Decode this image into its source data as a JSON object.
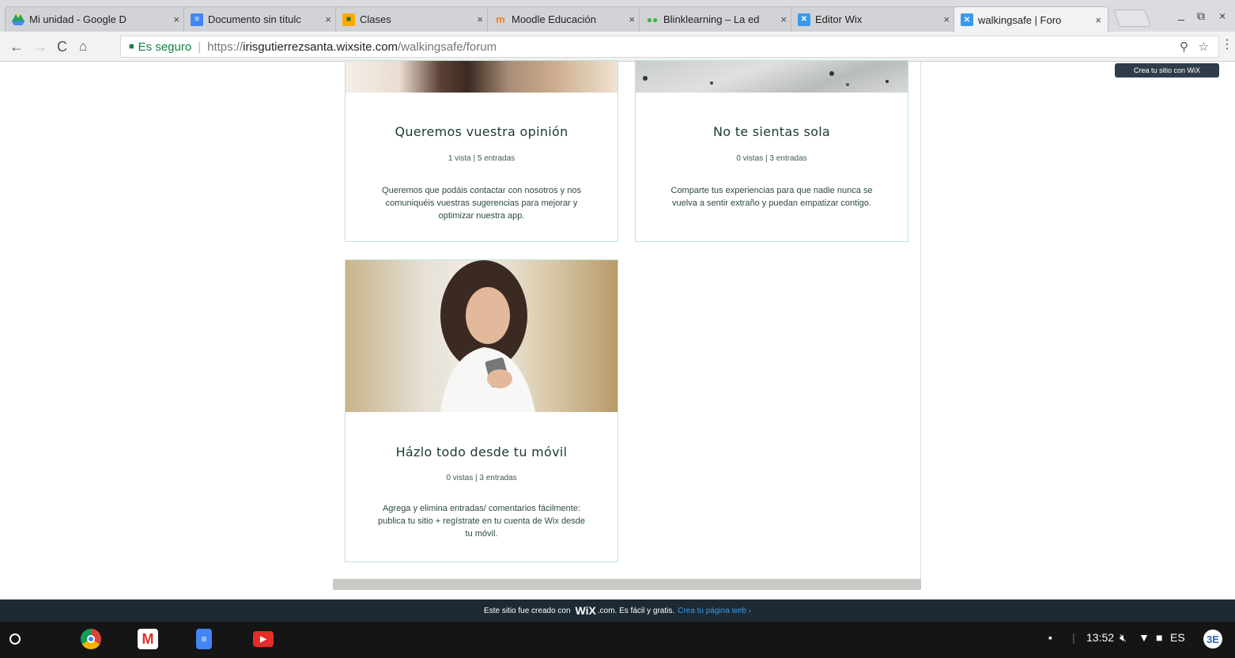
{
  "browser": {
    "tabs": [
      {
        "title": "Mi unidad - Google D",
        "icon": "drive-icon",
        "color": "#1fa463"
      },
      {
        "title": "Documento sin títulc",
        "icon": "docs-icon",
        "color": "#4285f4"
      },
      {
        "title": "Clases",
        "icon": "classroom-icon",
        "color": "#f9ab00"
      },
      {
        "title": "Moodle Educación",
        "icon": "moodle-icon",
        "color": "#f98012"
      },
      {
        "title": "Blinklearning – La ed",
        "icon": "blink-icon",
        "color": "#3ab54a"
      },
      {
        "title": "Editor Wix",
        "icon": "wix-icon",
        "color": "#3899ec"
      },
      {
        "title": "walkingsafe | Foro",
        "icon": "wix-icon",
        "color": "#3899ec"
      }
    ],
    "close_glyph": "×",
    "window_controls": [
      "_",
      "⧉",
      "×"
    ],
    "secure_label": "Es seguro",
    "url_scheme": "https://",
    "url_host": "irisgutierrezsanta.wixsite.com",
    "url_path": "/walkingsafe/forum"
  },
  "page": {
    "wix_badge": "Crea tu sitio con WiX",
    "cards": [
      {
        "title": "Queremos vuestra opinión",
        "meta": "1 vista | 5 entradas",
        "desc": "Queremos que podáis contactar con nosotros y nos comuniquéis vuestras sugerencias para mejorar y optimizar nuestra app."
      },
      {
        "title": "No te sientas sola",
        "meta": "0 vistas | 3 entradas",
        "desc": "Comparte tus experiencias para que nadie nunca se vuelva a sentir extraño y puedan empatizar contigo."
      },
      {
        "title": "Házlo todo desde tu móvil",
        "meta": "0 vistas | 3 entradas",
        "desc": "Agrega y elimina entradas/ comentarios fácilmente: publica tu sitio + regístrate en tu cuenta de Wix desde tu móvil."
      }
    ]
  },
  "banner": {
    "text_before": "Este sitio fue creado con",
    "brand": "WiX",
    "text_after": ".com. Es fácil y gratis.",
    "link": "Crea tu página web ›"
  },
  "shelf": {
    "apps": [
      "chrome-icon",
      "gmail-icon",
      "docs-icon",
      "youtube-icon"
    ],
    "time": "13:52",
    "lang": "ES"
  }
}
